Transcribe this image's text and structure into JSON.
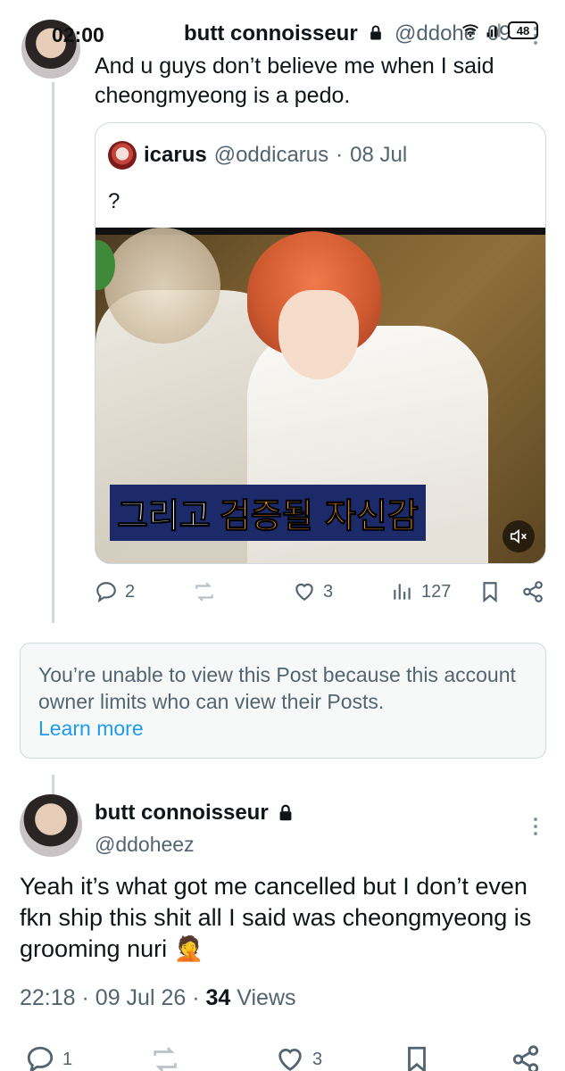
{
  "status_bar": {
    "time": "02:00",
    "battery": "48"
  },
  "post1": {
    "author_name": "butt connoisseur",
    "handle": "@ddohe",
    "truncated_date": "09 Jul",
    "text": "And u guys don’t believe me when I said cheongmyeong is a pedo.",
    "quote": {
      "author_name": "icarus",
      "handle": "@oddicarus",
      "date": "08 Jul",
      "text": "?",
      "caption_white": "그리고",
      "caption_orange": "검증될 자신감"
    },
    "actions": {
      "replies": "2",
      "reposts": "",
      "likes": "3",
      "views": "127"
    }
  },
  "unavailable": {
    "message": "You’re unable to view this Post because this account owner limits who can view their Posts.",
    "link": "Learn more"
  },
  "post2": {
    "author_name": "butt connoisseur",
    "handle": "@ddoheez",
    "text": "Yeah it’s what got me cancelled but I don’t even fkn ship this shit all I said was cheongmyeong is grooming nuri 🤦",
    "time": "22:18",
    "date": "09 Jul 26",
    "views_count": "34",
    "views_label": "Views",
    "actions": {
      "replies": "1",
      "likes": "3"
    }
  },
  "colors": {
    "text": "#0f1419",
    "secondary": "#536471",
    "link": "#1d9bf0",
    "border": "#cfd9de"
  }
}
